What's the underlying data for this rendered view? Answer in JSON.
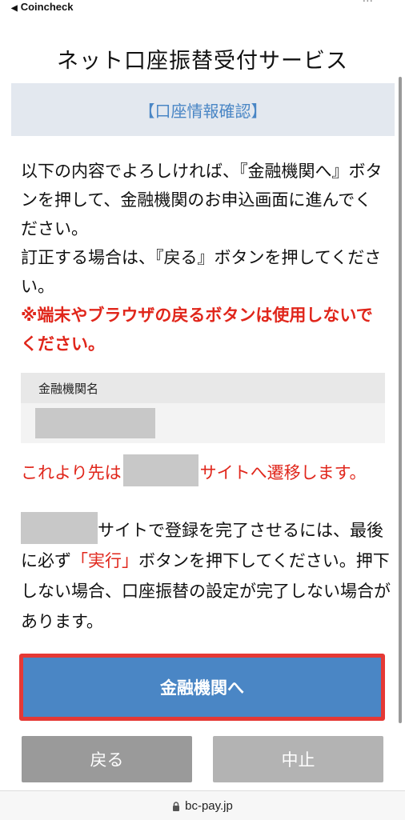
{
  "status_bar": {
    "back_arrow": "◀",
    "back_app": "Coincheck",
    "indicators": "···"
  },
  "page_title": "ネット口座振替受付サービス",
  "section_header": "【口座情報確認】",
  "intro": {
    "line1": "以下の内容でよろしければ、『金融機関へ』ボタンを押して、金融機関のお申込画面に進んでください。",
    "line2": "訂正する場合は、『戻る』ボタンを押してください。",
    "warning": "※端末やブラウザの戻るボタンは使用しないでください。"
  },
  "info_table": {
    "label": "金融機関名",
    "value_redacted": true
  },
  "transition_notice": {
    "prefix": "これより先は",
    "suffix": "サイトへ遷移します。"
  },
  "completion_notice": {
    "part1": "サイトで登録を完了させるには、最後に必ず",
    "exec_label": "「実行」",
    "part2": "ボタンを押下してください。押下しない場合、口座振替の設定が完了しない場合があります。"
  },
  "buttons": {
    "primary": "金融機関へ",
    "back": "戻る",
    "cancel": "中止"
  },
  "url_bar": {
    "url": "bc-pay.jp",
    "icon": "lock-icon"
  },
  "colors": {
    "accent_blue": "#4a86c5",
    "warning_red": "#e0261b",
    "highlight_border": "#e53935",
    "header_bg": "#e3e8ef"
  }
}
